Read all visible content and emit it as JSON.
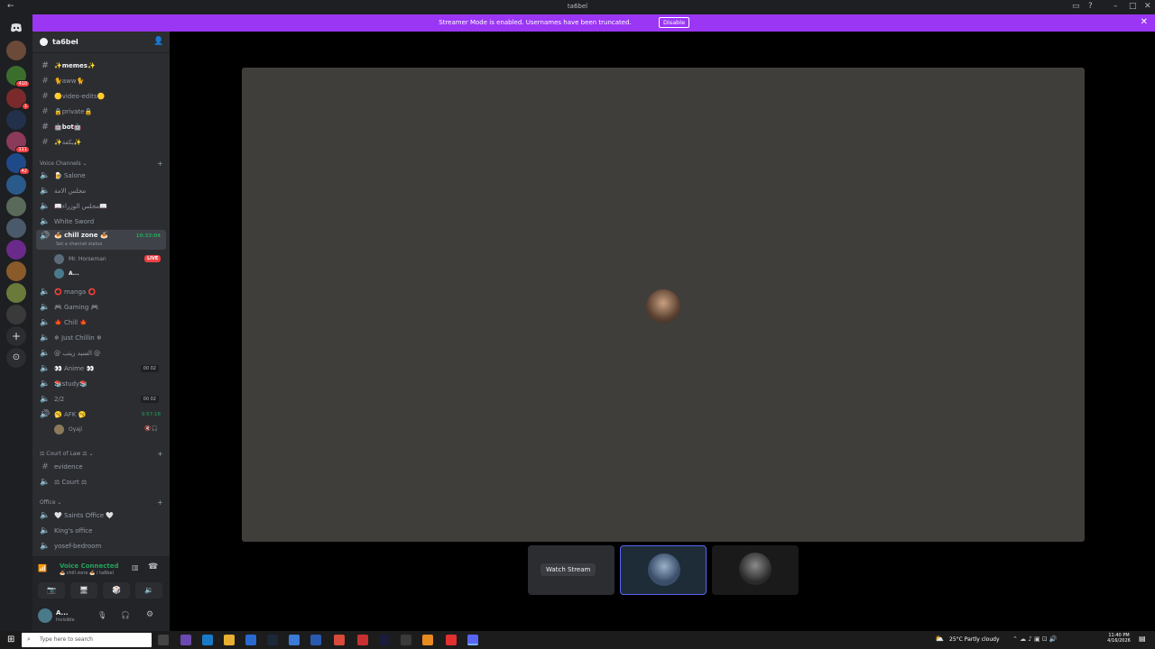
{
  "window": {
    "title": "ta6bel"
  },
  "banner": {
    "message": "Streamer Mode is enabled. Usernames have been truncated.",
    "disable_label": "Disable"
  },
  "rail": {
    "badges": [
      "410",
      "1",
      "111",
      "42"
    ]
  },
  "server": {
    "name": "ta6bel"
  },
  "text_channels": [
    {
      "name": "✨memes✨",
      "bold": true
    },
    {
      "name": "🐈aww🐈",
      "bold": false
    },
    {
      "name": "🟡video-edits🟡",
      "bold": false
    },
    {
      "name": "🔒private🔒",
      "bold": false
    },
    {
      "name": "🤖bot🤖",
      "bold": true
    },
    {
      "name": "✨يكفة✨",
      "bold": false
    }
  ],
  "voice_category": "Voice Channels",
  "voice_channels_top": [
    {
      "name": "🍺 Salone"
    },
    {
      "name": "مجلس الامة"
    },
    {
      "name": "📖مجلس الوزراء📖"
    },
    {
      "name": "White Sword"
    }
  ],
  "active_voice": {
    "name": "🍝 chill zone 🍝",
    "status": "Set a channel status",
    "timer": "10:33:04"
  },
  "active_members": [
    {
      "name": "Mr. Horseman",
      "live": "LIVE"
    },
    {
      "name": "A..."
    }
  ],
  "voice_channels_mid": [
    {
      "name": "⭕ manga ⭕",
      "count": ""
    },
    {
      "name": "🎮 Gaming 🎮",
      "count": ""
    },
    {
      "name": "🍁 Chill 🍁",
      "count": ""
    },
    {
      "name": "❄ Just Chillin ❄",
      "count": ""
    },
    {
      "name": "@ السيد زيتب @",
      "count": ""
    },
    {
      "name": "👀 Anime 👀",
      "count": "00 02"
    },
    {
      "name": "📚study📚",
      "count": ""
    },
    {
      "name": "2/2",
      "count": "00 02"
    }
  ],
  "afk": {
    "name": "🥱 AFK 🥱",
    "timer": "9:57:18",
    "member": "Oyaji"
  },
  "court_category": "⚖ Court of Law ⚖",
  "court_channels": [
    {
      "name": "evidence"
    },
    {
      "name": "⚖ Court ⚖"
    }
  ],
  "office_category": "Office",
  "office_channels": [
    {
      "name": "🤍 Saints Office 🤍"
    },
    {
      "name": "King's office"
    },
    {
      "name": "yosef-bedroom"
    }
  ],
  "voice_panel": {
    "status": "Voice Connected",
    "location": "🍝 chill zone 🍝 / ta6bel"
  },
  "user": {
    "name": "A...",
    "status": "Invisible"
  },
  "stage": {
    "watch_label": "Watch Stream"
  },
  "taskbar": {
    "search_placeholder": "Type here to search",
    "weather": "25°C  Partly cloudy",
    "time": "11:40 PM",
    "date": "4/16/2026"
  },
  "colors": {
    "accent": "#9b36f5",
    "live": "#ed4245",
    "connected": "#23a55a"
  }
}
